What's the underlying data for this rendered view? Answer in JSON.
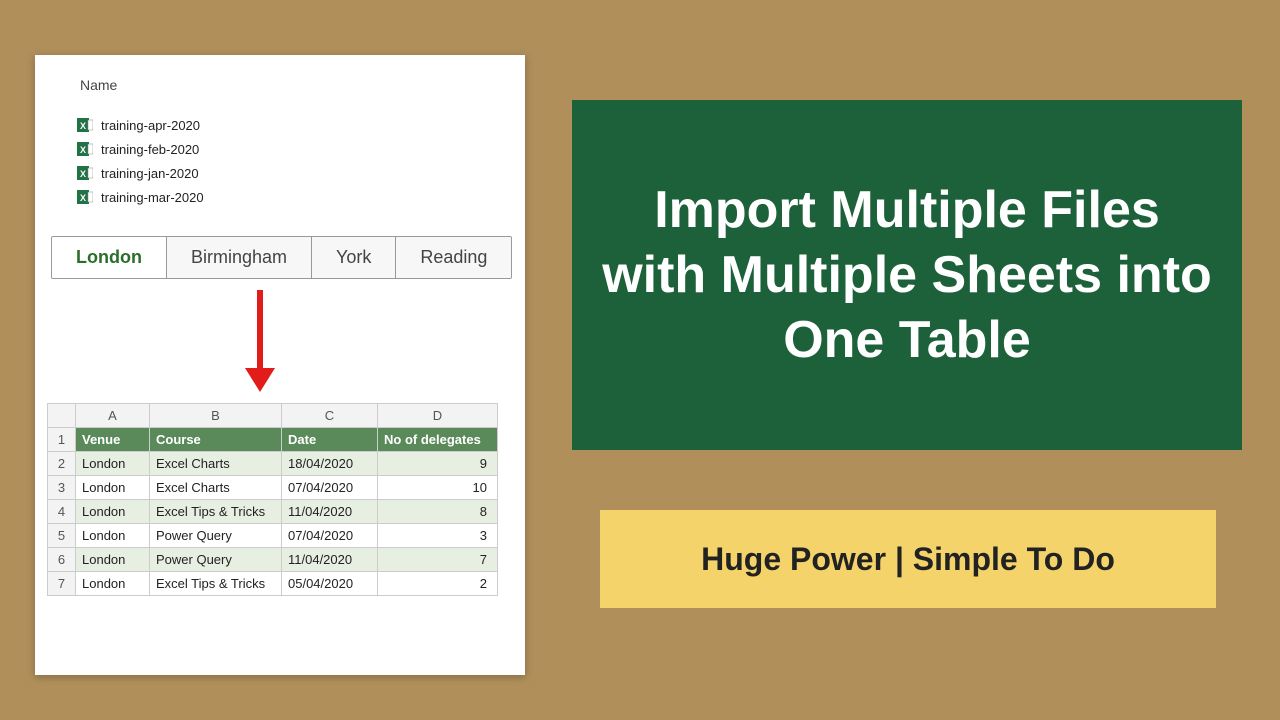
{
  "left": {
    "name_label": "Name",
    "files": [
      "training-apr-2020",
      "training-feb-2020",
      "training-jan-2020",
      "training-mar-2020"
    ],
    "tabs": [
      "London",
      "Birmingham",
      "York",
      "Reading"
    ],
    "active_tab_index": 0,
    "columns": [
      "A",
      "B",
      "C",
      "D"
    ],
    "headers": [
      "Venue",
      "Course",
      "Date",
      "No of delegates"
    ],
    "rows": [
      {
        "n": "2",
        "venue": "London",
        "course": "Excel Charts",
        "date": "18/04/2020",
        "delegates": "9"
      },
      {
        "n": "3",
        "venue": "London",
        "course": "Excel Charts",
        "date": "07/04/2020",
        "delegates": "10"
      },
      {
        "n": "4",
        "venue": "London",
        "course": "Excel Tips & Tricks",
        "date": "11/04/2020",
        "delegates": "8"
      },
      {
        "n": "5",
        "venue": "London",
        "course": "Power Query",
        "date": "07/04/2020",
        "delegates": "3"
      },
      {
        "n": "6",
        "venue": "London",
        "course": "Power Query",
        "date": "11/04/2020",
        "delegates": "7"
      },
      {
        "n": "7",
        "venue": "London",
        "course": "Excel Tips & Tricks",
        "date": "05/04/2020",
        "delegates": "2"
      }
    ]
  },
  "right": {
    "title": "Import Multiple Files with Multiple Sheets into One Table",
    "subtitle": "Huge Power | Simple To Do"
  }
}
